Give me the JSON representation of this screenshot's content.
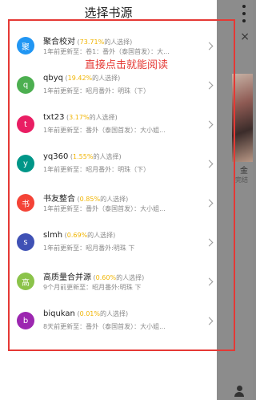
{
  "drawer": {
    "title": "选择书源"
  },
  "annotation": {
    "text": "直接点击就能阅读",
    "color": "#e53935"
  },
  "sources": [
    {
      "avatar": "聚",
      "avatar_color": "#2196f3",
      "name": "聚合校对",
      "pct": "73.71%",
      "suffix": "的人选择)",
      "latest": "1年前更新至：卷1：番外（泰国首发）：大..."
    },
    {
      "avatar": "q",
      "avatar_color": "#4caf50",
      "name": "qbyq",
      "pct": "19.42%",
      "suffix": "的人选择)",
      "latest": "1年前更新至：昭月番外：明珠（下）"
    },
    {
      "avatar": "t",
      "avatar_color": "#e91e63",
      "name": "txt23",
      "pct": "3.17%",
      "suffix": "的人选择)",
      "latest": "1年前更新至：番外（泰国首发）：大小姐..."
    },
    {
      "avatar": "y",
      "avatar_color": "#009688",
      "name": "yq360",
      "pct": "1.55%",
      "suffix": "的人选择)",
      "latest": "1年前更新至：昭月番外：明珠（下）"
    },
    {
      "avatar": "书",
      "avatar_color": "#f44336",
      "name": "书友整合",
      "pct": "0.85%",
      "suffix": "的人选择)",
      "latest": "1年前更新至：番外（泰国首发）：大小姐..."
    },
    {
      "avatar": "s",
      "avatar_color": "#3f51b5",
      "name": "slmh",
      "pct": "0.69%",
      "suffix": "的人选择)",
      "latest": "1年前更新至：昭月番外:明珠 下"
    },
    {
      "avatar": "高",
      "avatar_color": "#8bc34a",
      "name": "高质量合并源",
      "pct": "0.60%",
      "suffix": "的人选择)",
      "latest": "9个月前更新至：昭月番外:明珠 下"
    },
    {
      "avatar": "b",
      "avatar_color": "#9c27b0",
      "name": "biqukan",
      "pct": "0.01%",
      "suffix": "的人选择)",
      "latest": "8天前更新至：番外（泰国首发）：大小姐..."
    }
  ],
  "background": {
    "close_glyph": "×",
    "cover_title": "金",
    "cover_sub": "完结"
  },
  "icons": {
    "menu": "more-vertical-icon",
    "close": "close-icon",
    "chevron": "chevron-right-icon",
    "profile": "profile-icon"
  }
}
